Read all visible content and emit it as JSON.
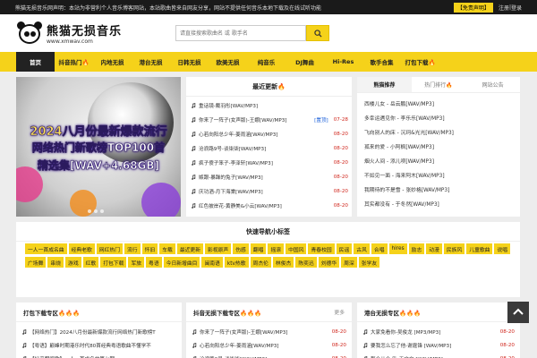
{
  "topbar": {
    "notice": "熊猫无损音乐网声明：本站为非营利个人音乐博客网站，本站歌曲皆来自网友分享，网站不提供任何音乐本地下载及在线试听功能",
    "disclaimer": "【免责声明】",
    "register": "注册",
    "sep": "|",
    "login": "登录"
  },
  "logo": {
    "title": "熊猫无损音乐",
    "url": "www.xmwav.com"
  },
  "search": {
    "placeholder": "请直接搜索歌曲名 或 歌手名"
  },
  "nav": [
    {
      "label": "首页",
      "active": true
    },
    {
      "label": "抖音热门🔥"
    },
    {
      "label": "内地无损"
    },
    {
      "label": "港台无损"
    },
    {
      "label": "日韩无损"
    },
    {
      "label": "欧美无损"
    },
    {
      "label": "纯音乐"
    },
    {
      "label": "DJ舞曲"
    },
    {
      "label": "Hi-Res"
    },
    {
      "label": "歌手合集"
    },
    {
      "label": "打包下载🔥"
    }
  ],
  "banner": {
    "line1": "2024八月份最新爆款流行",
    "line2": "网络热门新歌榜TOP100首",
    "line3": "精选集[WAV+4.68GB]"
  },
  "latest": {
    "title": "最近更新🔥",
    "items": [
      {
        "title": "重话镜-戴羽彤[WAV/MP3]",
        "note": "",
        "date": ""
      },
      {
        "title": "你来了一阵子(女声版)-王娜[WAV/MP3]",
        "note": "[置顶]",
        "date": "07-28"
      },
      {
        "title": "心若向阳总少年-姜雨涵[WAV/MP3]",
        "note": "",
        "date": "08-20"
      },
      {
        "title": "沧浪路9号-谈柒柒[WAV/MP3]",
        "note": "",
        "date": "08-20"
      },
      {
        "title": "疯子傻子笨子-李泽轩[WAV/MP3]",
        "note": "",
        "date": "08-20"
      },
      {
        "title": "嫉跟-暴躁的兔子[WAV/MP3]",
        "note": "",
        "date": "08-20"
      },
      {
        "title": "庆功酒-月下海棠[WAV/MP3]",
        "note": "",
        "date": "08-20"
      },
      {
        "title": "红色披岸花-黄静美&小云[WAV/MP3]",
        "note": "",
        "date": "08-20"
      }
    ]
  },
  "ranks": {
    "tabs": [
      "熊猫推荐",
      "热门排行🔥",
      "网站公告"
    ],
    "items": [
      "西楼儿女 - 岳云鹏[WAV/MP3]",
      "多幸运遇见你 - 李乐乐[WAV/MP3]",
      "飞向别人的床 - 沉珂&光光[WAV/MP3]",
      "孤来的爱 - 小阿枫[WAV/MP3]",
      "烟火人间 - 添儿呗[WAV/MP3]",
      "不如见一面 - 海来阿木[WAV/MP3]",
      "我期待的不是雪 - 张妙格[WAV/MP3]",
      "其实都没有 - 于冬然[WAV/MP3]"
    ]
  },
  "tags": {
    "title": "快速导航小标签",
    "items": [
      "一人一首成名曲",
      "经典老歌",
      "网红热门",
      "流行",
      "怀旧",
      "车载",
      "最近更新",
      "影视原声",
      "伤感",
      "翻唱",
      "摇滚",
      "中国风",
      "青春校园",
      "民谣",
      "古风",
      "合唱",
      "hires",
      "励志",
      "动漫",
      "民族风",
      "儿童歌曲",
      "说唱",
      "广场舞",
      "串烧",
      "游戏",
      "红歌",
      "打包下载",
      "军旅",
      "粤语",
      "今日新增曲目",
      "闽南语",
      "ktv热歌",
      "周杰伦",
      "林俊杰",
      "陈奕迅",
      "刘德华",
      "周深",
      "张学友"
    ]
  },
  "bottom": [
    {
      "title": "打包下载专区🔥🔥🔥",
      "more": "",
      "items": [
        {
          "title": "【网络热门】2024八月份最新爆款流行网络热门新歌榜T",
          "date": ""
        },
        {
          "title": "【粤语】巅峰时期港乐时代80首经典粤语歌曲不懂学不",
          "date": ""
        },
        {
          "title": "【抖音翻唱歌】一人一首成名曲第七期",
          "date": ""
        }
      ]
    },
    {
      "title": "抖音无损下载专区🔥🔥🔥",
      "more": "更多",
      "items": [
        {
          "title": "你来了一阵子(女声版)-王娜[WAV/MP3]",
          "date": "08-20"
        },
        {
          "title": "心若向阳总少年-姜雨涵[WAV/MP3]",
          "date": "08-20"
        },
        {
          "title": "沧浪路9号-谈柒柒[WAV/MP3]",
          "date": "08-20"
        }
      ]
    },
    {
      "title": "港台无损专区🔥🔥🔥",
      "more": "",
      "items": [
        {
          "title": "大家免看你-吴俊龙 [MP3/MP3]",
          "date": "08-20"
        },
        {
          "title": "要我怎么忘了他-谢霆锋 [WAV/MP3]",
          "date": "08-20"
        },
        {
          "title": "那会儿会,卧-于文文 [WAV/MP3]",
          "date": "08-20"
        }
      ]
    }
  ],
  "colors": {
    "accent": "#f5d21a",
    "dark": "#1a1a1a",
    "date_red": "#d0261c",
    "link_blue": "#1a5fd9"
  }
}
